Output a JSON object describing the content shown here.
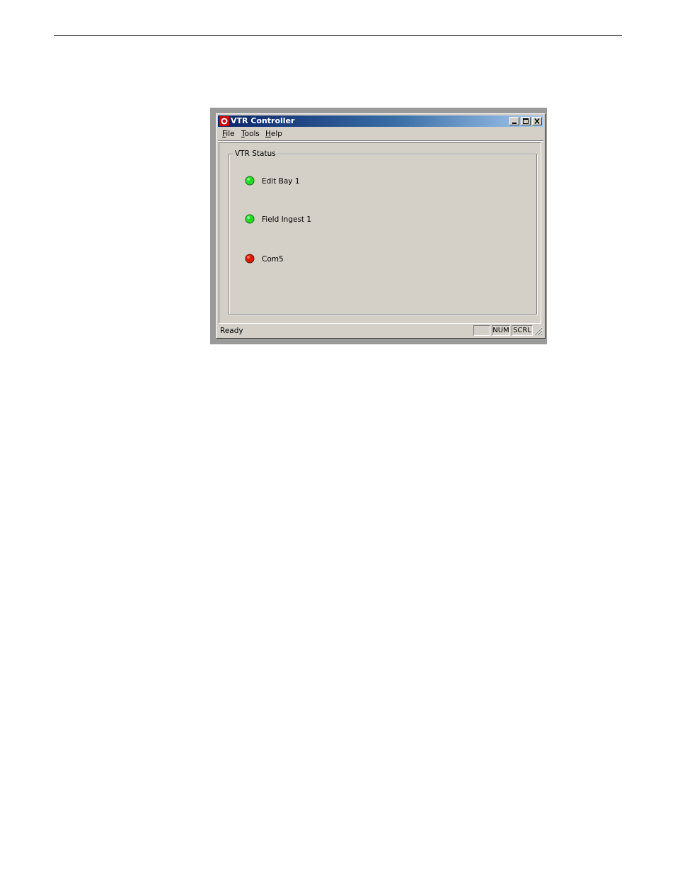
{
  "window": {
    "title": "VTR Controller",
    "controls": {
      "minimize_icon": "minimize-icon",
      "maximize_icon": "maximize-icon",
      "close_icon": "close-icon"
    }
  },
  "menu": {
    "items": [
      {
        "hotkey": "F",
        "rest": "ile"
      },
      {
        "hotkey": "T",
        "rest": "ools"
      },
      {
        "hotkey": "H",
        "rest": "elp"
      }
    ]
  },
  "vtr_status": {
    "group_label": "VTR Status",
    "items": [
      {
        "name": "Edit Bay 1",
        "status_color": "#00cc00"
      },
      {
        "name": "Field Ingest 1",
        "status_color": "#00cc00"
      },
      {
        "name": "Com5",
        "status_color": "#cc0000"
      }
    ]
  },
  "statusbar": {
    "text": "Ready",
    "indicators": [
      "",
      "NUM",
      "SCRL"
    ]
  }
}
